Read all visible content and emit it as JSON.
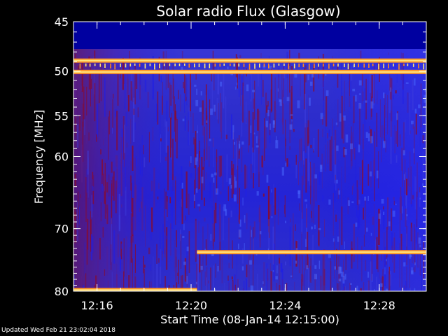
{
  "chart_data": {
    "type": "heatmap",
    "title": "Solar radio Flux (Glasgow)",
    "xlabel": "Start Time (08-Jan-14 12:15:00)",
    "ylabel": "Frequency [MHz]",
    "x_unit": "UT clock time (hh:mm)",
    "x_range": [
      "12:15:00",
      "12:30:00"
    ],
    "y_range": [
      45,
      80
    ],
    "y_scale": "log",
    "y_direction": "increasing downward",
    "x_ticks": [
      "12:16",
      "12:20",
      "12:24",
      "12:28"
    ],
    "y_ticks": [
      45,
      50,
      55,
      60,
      70,
      80
    ],
    "colormap": [
      "#0000b4",
      "#1e1ee6",
      "#3c3cdc",
      "#5a1e8c",
      "#8c0a28",
      "#b41e0a",
      "#ff8c1e",
      "#ffe678"
    ],
    "features": [
      {
        "label": "interference band",
        "frequency_mhz": 48.9,
        "start": "12:15:00",
        "end": "12:30:00"
      },
      {
        "label": "interference band",
        "frequency_mhz": 50.1,
        "start": "12:15:00",
        "end": "12:30:00"
      },
      {
        "label": "interference band",
        "frequency_mhz": 79.8,
        "start": "12:15:00",
        "end": "12:20:15"
      },
      {
        "label": "interference band",
        "frequency_mhz": 73.6,
        "start": "12:20:15",
        "end": "12:30:00"
      }
    ],
    "grid": false,
    "legend": "none"
  },
  "footer": {
    "updated": "Updated Wed Feb 21 23:02:04 2018"
  },
  "colors": {
    "background": "#000000",
    "text": "#ffffff",
    "deep_blue": "#0000a0",
    "band_orange": "#ff9a2a",
    "band_yellow": "#ffe680"
  }
}
